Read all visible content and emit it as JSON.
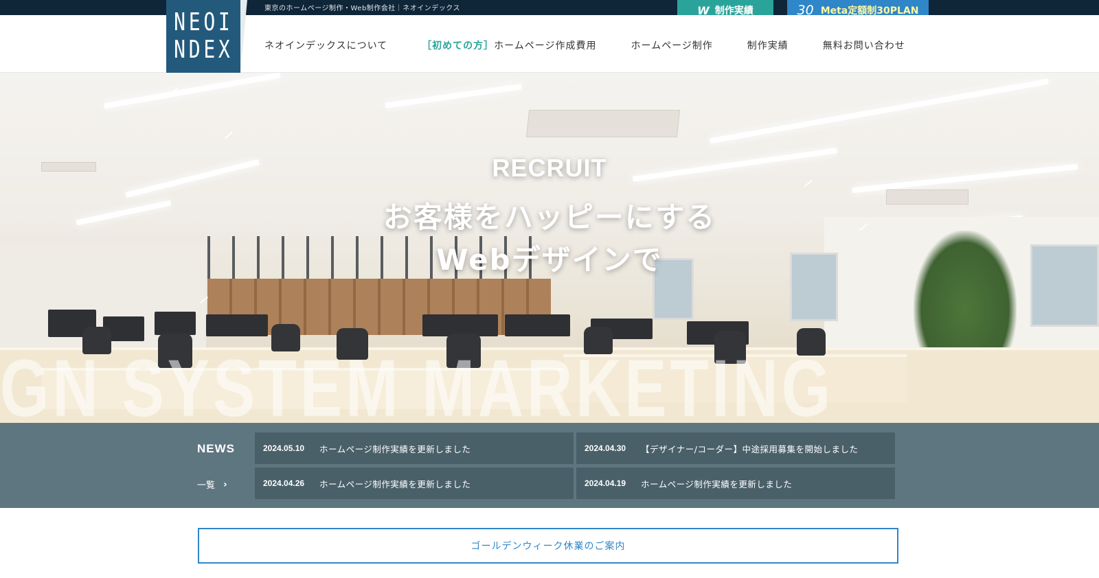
{
  "topbar": {
    "tagline": "東京のホームページ制作・Web制作会社｜ネオインデックス",
    "works_button": {
      "icon": "w-logo-icon",
      "label": "制作実績"
    },
    "plan_button": {
      "number": "30",
      "label": "Meta定額制30PLAN"
    }
  },
  "logo": {
    "line1": "NEOI",
    "line2": "NDEX"
  },
  "nav": {
    "about": "ネオインデックスについて",
    "first_bracket": "［初めての方］",
    "cost": "ホームページ作成費用",
    "production": "ホームページ制作",
    "works": "制作実績",
    "contact": "無料お問い合わせ"
  },
  "hero": {
    "kicker": "RECRUIT",
    "title_line1": "お客様をハッピーにする",
    "title_line2": "Webデザインで",
    "watermark": "GN SYSTEM MARKETING"
  },
  "news": {
    "title": "NEWS",
    "more_label": "一覧",
    "more_icon": "chevron-right-icon",
    "items": [
      {
        "date": "2024.05.10",
        "text": "ホームページ制作実績を更新しました"
      },
      {
        "date": "2024.04.30",
        "text": "【デザイナー/コーダー】中途採用募集を開始しました"
      },
      {
        "date": "2024.04.26",
        "text": "ホームページ制作実績を更新しました"
      },
      {
        "date": "2024.04.19",
        "text": "ホームページ制作実績を更新しました"
      }
    ]
  },
  "notice": {
    "label": "ゴールデンウィーク休業のご案内"
  },
  "colors": {
    "navy": "#0f2538",
    "logo_blue": "#235a7c",
    "teal": "#2aa49a",
    "blue": "#2f86c8",
    "news_bg": "#5e7680"
  }
}
